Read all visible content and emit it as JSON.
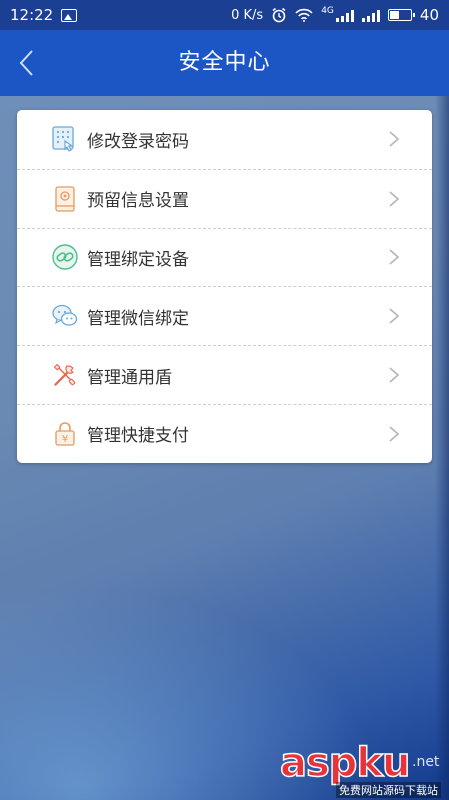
{
  "status_bar": {
    "time": "12:22",
    "net_speed": "0 K/s",
    "network": "4G",
    "battery": "40",
    "battery_level": 0.4,
    "icons": [
      "image-icon",
      "alarm-icon",
      "wifi-icon",
      "signal-icon",
      "battery-icon"
    ]
  },
  "header": {
    "title": "安全中心",
    "back_icon": "chevron-left-icon"
  },
  "menu": {
    "items": [
      {
        "label": "修改登录密码",
        "icon": "keypad-icon"
      },
      {
        "label": "预留信息设置",
        "icon": "phone-gear-icon"
      },
      {
        "label": "管理绑定设备",
        "icon": "link-icon"
      },
      {
        "label": "管理微信绑定",
        "icon": "wechat-icon"
      },
      {
        "label": "管理通用盾",
        "icon": "tools-icon"
      },
      {
        "label": "管理快捷支付",
        "icon": "lock-yuan-icon"
      }
    ],
    "chevron_icon": "chevron-right-icon"
  },
  "watermark": {
    "text": "aspku",
    "suffix": ".net",
    "subtitle": "免费网站源码下载站"
  },
  "colors": {
    "status_bar": "#1a3f93",
    "title_bar": "#1b56c4",
    "card": "#ffffff",
    "label_text": "#333333",
    "chevron": "#b9b9b9",
    "watermark": "#e8333a"
  }
}
